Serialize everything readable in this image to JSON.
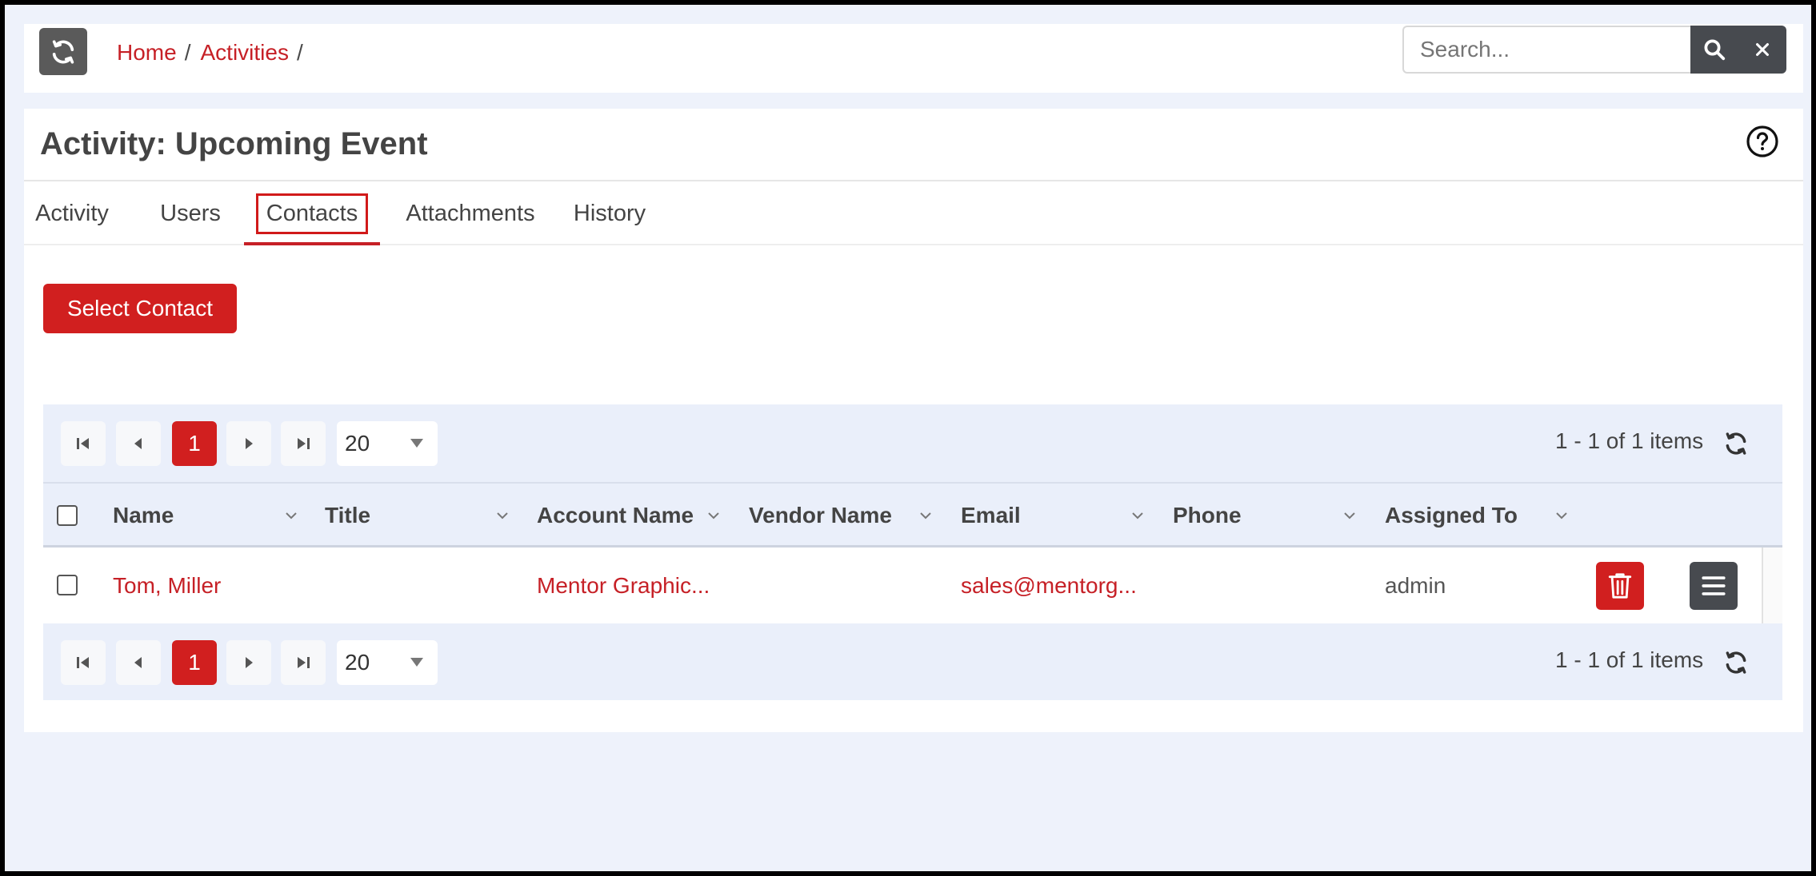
{
  "breadcrumb": {
    "home": "Home",
    "activities": "Activities",
    "sep": "/"
  },
  "search": {
    "placeholder": "Search..."
  },
  "page": {
    "title": "Activity: Upcoming Event"
  },
  "tabs": [
    {
      "label": "Activity"
    },
    {
      "label": "Users"
    },
    {
      "label": "Contacts"
    },
    {
      "label": "Attachments"
    },
    {
      "label": "History"
    }
  ],
  "actions": {
    "select_contact": "Select Contact"
  },
  "pager": {
    "current_page": "1",
    "page_size": "20",
    "info": "1 - 1 of 1 items"
  },
  "columns": [
    {
      "label": "Name"
    },
    {
      "label": "Title"
    },
    {
      "label": "Account Name"
    },
    {
      "label": "Vendor Name"
    },
    {
      "label": "Email"
    },
    {
      "label": "Phone"
    },
    {
      "label": "Assigned To"
    }
  ],
  "rows": [
    {
      "name": "Tom, Miller",
      "title": "",
      "account_name": "Mentor Graphic...",
      "vendor_name": "",
      "email": "sales@mentorg...",
      "phone": "",
      "assigned_to": "admin"
    }
  ],
  "colors": {
    "accent": "#d11f1f",
    "link": "#c62026",
    "dark_button": "#474a4f"
  }
}
